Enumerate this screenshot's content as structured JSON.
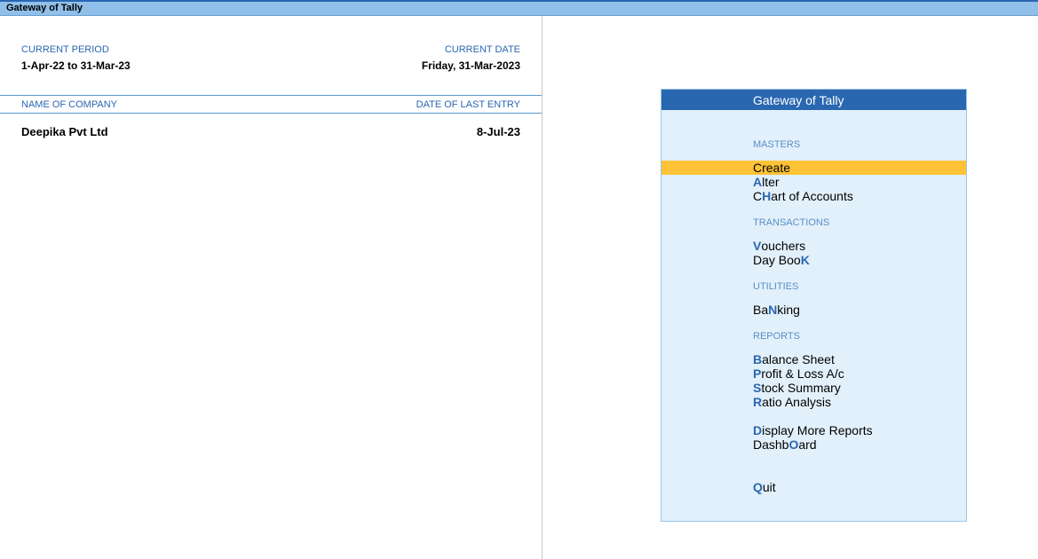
{
  "window": {
    "title": "Gateway of Tally"
  },
  "company_info": {
    "current_period_label": "CURRENT PERIOD",
    "current_period": "1-Apr-22 to 31-Mar-23",
    "current_date_label": "CURRENT DATE",
    "current_date": "Friday, 31-Mar-2023",
    "name_of_company_label": "NAME OF COMPANY",
    "date_of_last_entry_label": "DATE OF LAST ENTRY",
    "company_name": "Deepika Pvt Ltd",
    "last_entry_date": "8-Jul-23"
  },
  "gateway": {
    "title": "Gateway of Tally",
    "selected_item": "Create",
    "colors": {
      "header": "#2a67b1",
      "selection": "#fdc235",
      "panel": "#e2f0fb",
      "hotkey": "#2a67b1"
    },
    "sections": {
      "masters": {
        "label": "MASTERS",
        "items": [
          {
            "pre": "",
            "key": "",
            "post": "Create"
          },
          {
            "pre": "",
            "key": "A",
            "post": "lter"
          },
          {
            "pre": "C",
            "key": "H",
            "post": "art of Accounts"
          }
        ]
      },
      "transactions": {
        "label": "TRANSACTIONS",
        "items": [
          {
            "pre": "",
            "key": "V",
            "post": "ouchers"
          },
          {
            "pre": "Day Boo",
            "key": "K",
            "post": ""
          }
        ]
      },
      "utilities": {
        "label": "UTILITIES",
        "items": [
          {
            "pre": "Ba",
            "key": "N",
            "post": "king"
          }
        ]
      },
      "reports": {
        "label": "REPORTS",
        "items": [
          {
            "pre": "",
            "key": "B",
            "post": "alance Sheet"
          },
          {
            "pre": "",
            "key": "P",
            "post": "rofit & Loss A/c"
          },
          {
            "pre": "",
            "key": "S",
            "post": "tock Summary"
          },
          {
            "pre": "",
            "key": "R",
            "post": "atio Analysis"
          },
          {
            "pre": "",
            "key": "D",
            "post": "isplay More Reports"
          },
          {
            "pre": "Dashb",
            "key": "O",
            "post": "ard"
          }
        ]
      },
      "quit": {
        "items": [
          {
            "pre": "",
            "key": "Q",
            "post": "uit"
          }
        ]
      }
    }
  }
}
